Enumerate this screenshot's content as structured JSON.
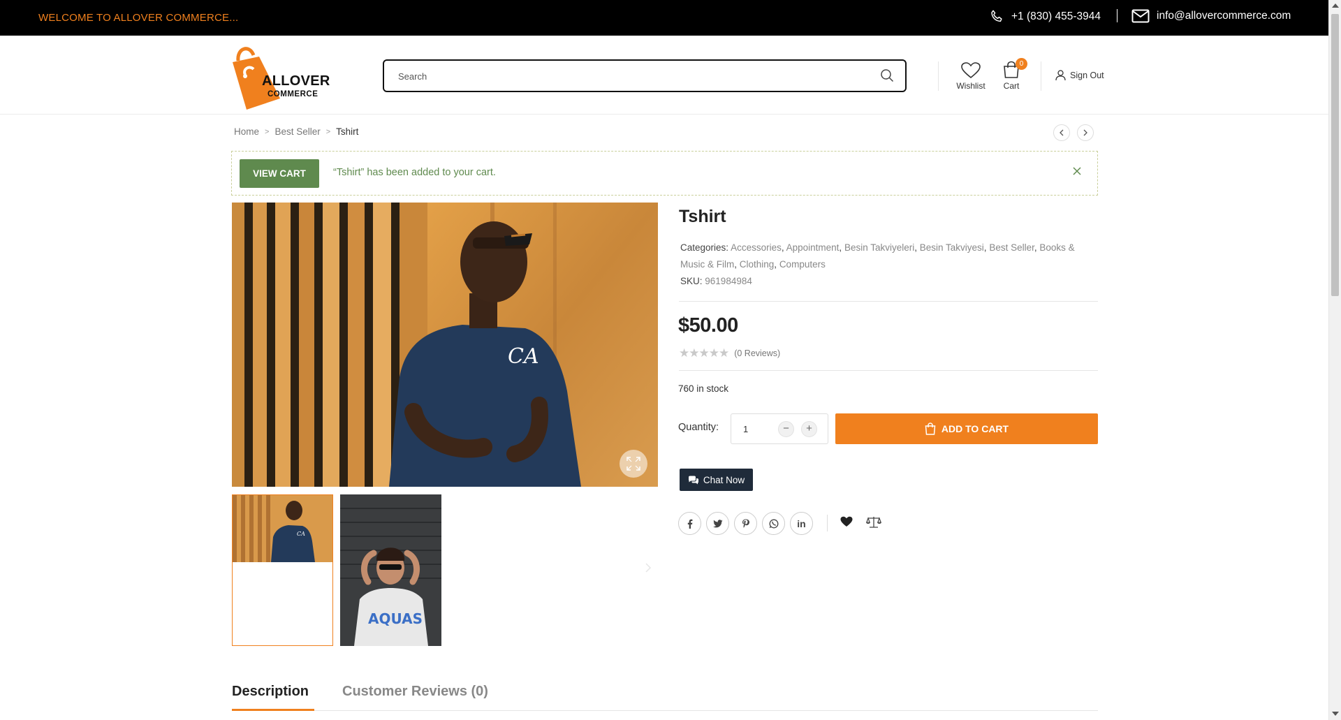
{
  "topbar": {
    "welcome": "WELCOME TO ALLOVER COMMERCE...",
    "phone": "+1 (830) 455-3944",
    "email": "info@allovercommerce.com"
  },
  "header": {
    "logo_line1": "ALLOVER",
    "logo_line2": "COMMERCE",
    "search_placeholder": "Search",
    "wishlist_label": "Wishlist",
    "cart_label": "Cart",
    "cart_count": "0",
    "signout_label": "Sign Out"
  },
  "breadcrumb": {
    "items": [
      "Home",
      "Best Seller",
      "Tshirt"
    ],
    "separator": ">"
  },
  "notice": {
    "button": "VIEW CART",
    "message": "“Tshirt” has been added to your cart."
  },
  "product": {
    "title": "Tshirt",
    "categories_label": "Categories:",
    "categories": [
      "Accessories",
      "Appointment",
      "Besin Takviyeleri",
      "Besin Takviyesi",
      "Best Seller",
      "Books & Music & Film",
      "Clothing",
      "Computers"
    ],
    "sku_label": "SKU:",
    "sku": "961984984",
    "price": "$50.00",
    "rating": 0,
    "reviews": "(0 Reviews)",
    "stock": "760 in stock",
    "quantity_label": "Quantity:",
    "quantity": "1",
    "add_to_cart": "ADD TO CART",
    "chat": "Chat Now",
    "minus": "−",
    "plus": "+"
  },
  "share": [
    "facebook",
    "twitter",
    "pinterest",
    "whatsapp",
    "linkedin"
  ],
  "share_labels": {
    "linkedin": "in"
  },
  "tabs": {
    "description": "Description",
    "reviews": "Customer Reviews (0)"
  },
  "colors": {
    "accent": "#f0801e",
    "notice_green": "#5f8a4e",
    "topbar": "#000000",
    "chat_bg": "#1f2b3a"
  }
}
